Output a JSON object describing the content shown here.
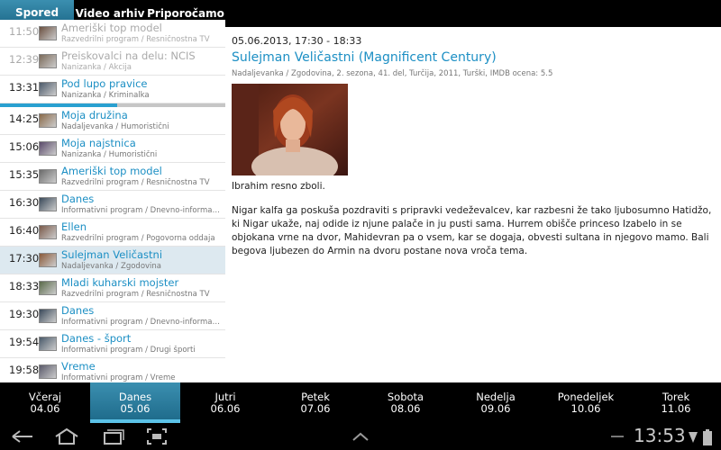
{
  "tabs": [
    {
      "label": "Spored"
    },
    {
      "label": "Video arhiv"
    },
    {
      "label": "Priporočamo"
    }
  ],
  "schedule": [
    {
      "time": "11:50",
      "title": "Ameriški top model",
      "sub": "Razvedrilni program / Resničnostna TV",
      "state": "dim"
    },
    {
      "time": "12:39",
      "title": "Preiskovalci na delu: NCIS",
      "sub": "Nanizanka / Akcija",
      "state": "dim"
    },
    {
      "time": "13:31",
      "title": "Pod lupo pravice",
      "sub": "Nanizanka / Kriminalka",
      "state": "current"
    },
    {
      "time": "14:25",
      "title": "Moja družina",
      "sub": "Nadaljevanka / Humoristični",
      "state": ""
    },
    {
      "time": "15:06",
      "title": "Moja najstnica",
      "sub": "Nanizanka / Humoristični",
      "state": ""
    },
    {
      "time": "15:35",
      "title": "Ameriški top model",
      "sub": "Razvedrilni program / Resničnostna TV",
      "state": ""
    },
    {
      "time": "16:30",
      "title": "Danes",
      "sub": "Informativni program / Dnevno-informat...",
      "state": ""
    },
    {
      "time": "16:40",
      "title": "Ellen",
      "sub": "Razvedrilni program / Pogovorna oddaja",
      "state": ""
    },
    {
      "time": "17:30",
      "title": "Sulejman Veličastni",
      "sub": "Nadaljevanka / Zgodovina",
      "state": "selected"
    },
    {
      "time": "18:33",
      "title": "Mladi kuharski mojster",
      "sub": "Razvedrilni program / Resničnostna TV",
      "state": ""
    },
    {
      "time": "19:30",
      "title": "Danes",
      "sub": "Informativni program / Dnevno-informat...",
      "state": ""
    },
    {
      "time": "19:54",
      "title": "Danes - šport",
      "sub": "Informativni program / Drugi športi",
      "state": ""
    },
    {
      "time": "19:58",
      "title": "Vreme",
      "sub": "Informativni program / Vreme",
      "state": ""
    }
  ],
  "detail": {
    "datetime": "05.06.2013, 17:30 - 18:33",
    "title": "Sulejman Veličastni (Magnificent Century)",
    "meta": "Nadaljevanka / Zgodovina, 2. sezona, 41. del, Turčija, 2011, Turški, IMDB ocena: 5.5",
    "p1": "Ibrahim resno zboli.",
    "p2": "Nigar kalfa ga poskuša pozdraviti s pripravki vedeževalcev, kar razbesni že tako ljubosumno Hatidžo, ki Nigar ukaže, naj odide iz njune palače in ju pusti sama. Hurrem obišče princeso Izabelo in se objokana vrne na dvor, Mahidevran pa o vsem, kar se dogaja, obvesti sultana in njegovo mamo. Bali begova ljubezen do Armin na dvoru postane nova vroča tema."
  },
  "days": [
    {
      "name": "Včeraj",
      "date": "04.06"
    },
    {
      "name": "Danes",
      "date": "05.06"
    },
    {
      "name": "Jutri",
      "date": "06.06"
    },
    {
      "name": "Petek",
      "date": "07.06"
    },
    {
      "name": "Sobota",
      "date": "08.06"
    },
    {
      "name": "Nedelja",
      "date": "09.06"
    },
    {
      "name": "Ponedeljek",
      "date": "10.06"
    },
    {
      "name": "Torek",
      "date": "11.06"
    }
  ],
  "system": {
    "clock": "13:53"
  },
  "icons": {
    "back": "back-icon",
    "home": "home-icon",
    "recents": "recent-apps-icon",
    "screenshot": "screenshot-icon",
    "up": "chevron-up-icon",
    "minus": "minus-icon",
    "battery": "battery-icon",
    "signal": "signal-icon"
  },
  "colors": {
    "accent": "#1c8fc4",
    "active_tab": "#2a7fa0",
    "selected_row": "#dde9f0"
  }
}
